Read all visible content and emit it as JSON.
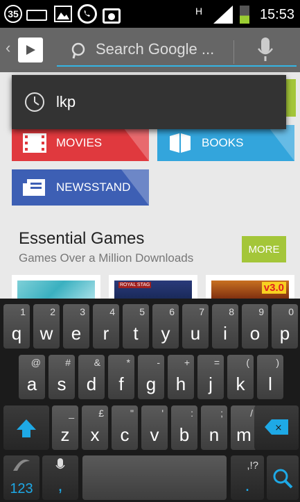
{
  "status_bar": {
    "notification_count": "35",
    "network_type": "H",
    "time": "15:53",
    "icons": [
      "keyboard-icon",
      "gallery-icon",
      "whatsapp-icon",
      "shopping-bag-icon",
      "signal-icon",
      "battery-icon"
    ]
  },
  "action_bar": {
    "search_placeholder": "Search Google ...",
    "icons": [
      "back-chevron-icon",
      "play-store-icon",
      "search-icon",
      "mic-icon"
    ]
  },
  "suggestion": {
    "text": "lkp",
    "icon": "history-clock-icon"
  },
  "tiles": {
    "movies": "MOVIES",
    "books": "BOOKS",
    "newsstand": "NEWSSTAND"
  },
  "section": {
    "title": "Essential Games",
    "subtitle": "Games Over a Million Downloads",
    "more_label": "MORE",
    "game_badge_1": "ROYAL STAG",
    "game_badge_2": "v3.0"
  },
  "colors": {
    "movies": "#e0393e",
    "books": "#33a5dc",
    "newsstand": "#3d5fb4",
    "accent_green": "#a4c639",
    "search_underline": "#34b5e5",
    "key_blue": "#1ea9e6"
  },
  "keyboard": {
    "row1": [
      {
        "p": "q",
        "s": "1"
      },
      {
        "p": "w",
        "s": "2"
      },
      {
        "p": "e",
        "s": "3"
      },
      {
        "p": "r",
        "s": "4"
      },
      {
        "p": "t",
        "s": "5"
      },
      {
        "p": "y",
        "s": "6"
      },
      {
        "p": "u",
        "s": "7"
      },
      {
        "p": "i",
        "s": "8"
      },
      {
        "p": "o",
        "s": "9"
      },
      {
        "p": "p",
        "s": "0"
      }
    ],
    "row2": [
      {
        "p": "a",
        "s": "@"
      },
      {
        "p": "s",
        "s": "#"
      },
      {
        "p": "d",
        "s": "&"
      },
      {
        "p": "f",
        "s": "*"
      },
      {
        "p": "g",
        "s": "-"
      },
      {
        "p": "h",
        "s": "+"
      },
      {
        "p": "j",
        "s": "="
      },
      {
        "p": "k",
        "s": "("
      },
      {
        "p": "l",
        "s": ")"
      }
    ],
    "row3": [
      {
        "p": "z",
        "s": "_"
      },
      {
        "p": "x",
        "s": "£"
      },
      {
        "p": "c",
        "s": "\""
      },
      {
        "p": "v",
        "s": "'"
      },
      {
        "p": "b",
        "s": ":"
      },
      {
        "p": "n",
        "s": ";"
      },
      {
        "p": "m",
        "s": "/"
      }
    ],
    "sym_label": "123",
    "comma_label": ",",
    "period_label": ".",
    "punct_label": ",!?"
  }
}
